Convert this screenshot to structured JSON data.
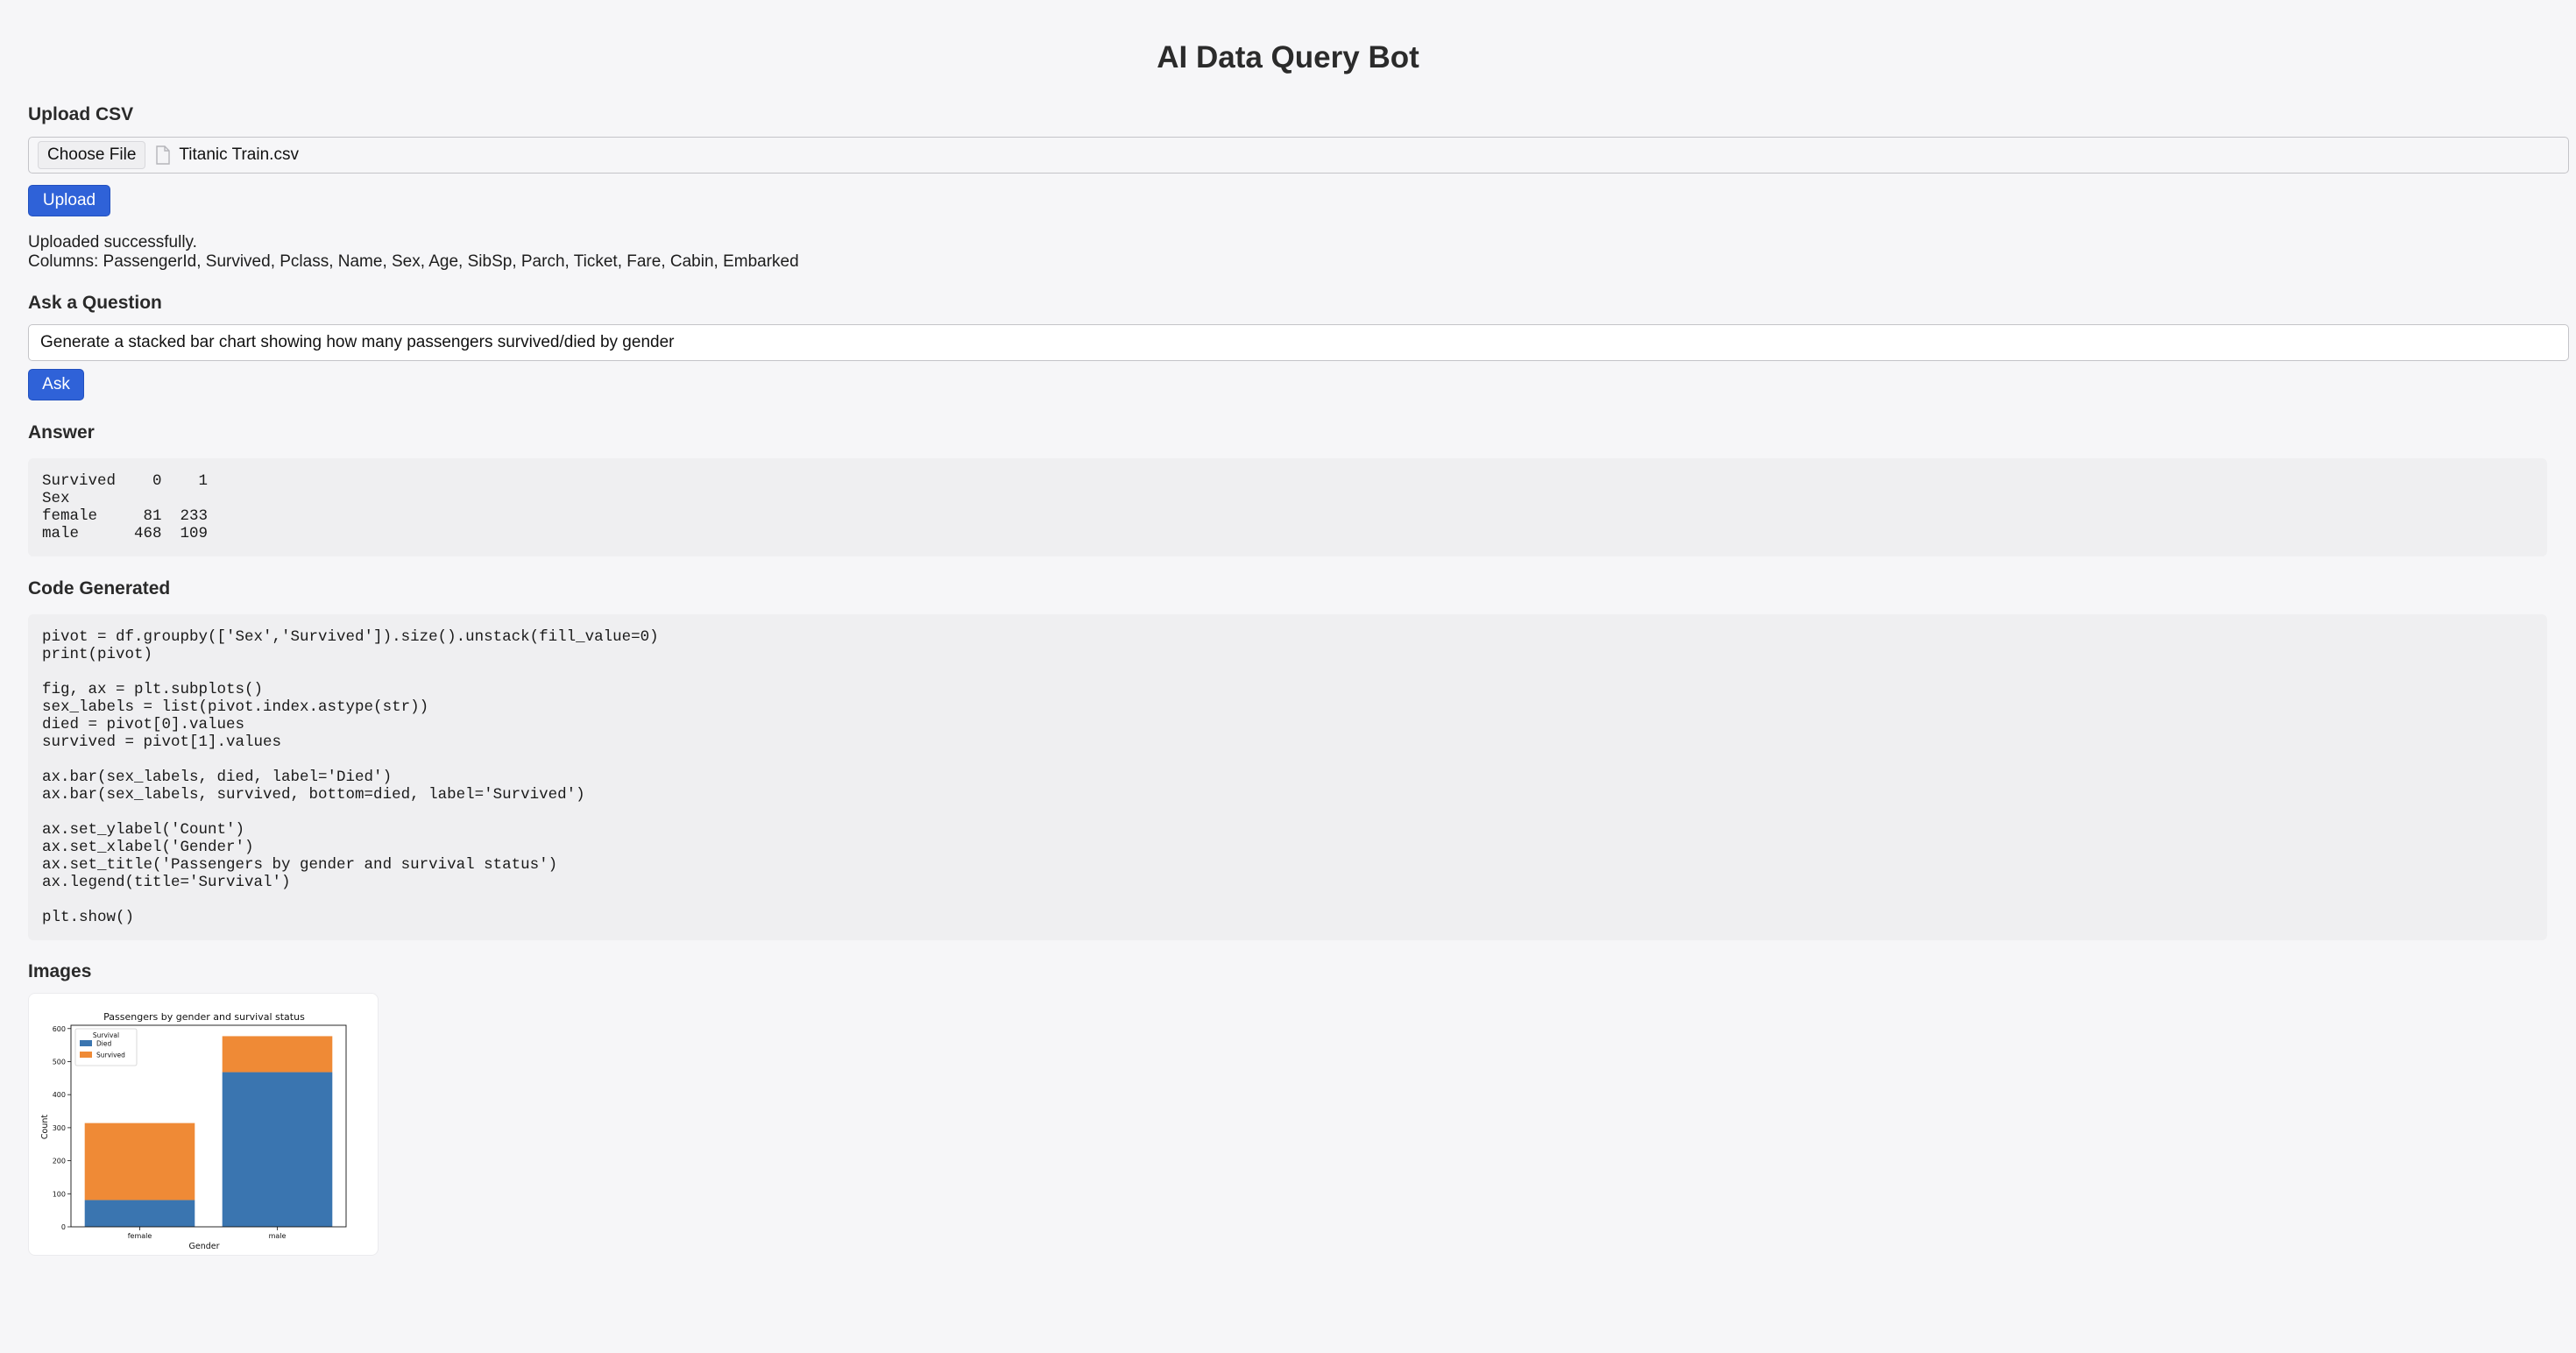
{
  "app": {
    "title": "AI Data Query Bot"
  },
  "upload": {
    "heading": "Upload CSV",
    "choose_file_label": "Choose File",
    "file_name": "Titanic Train.csv",
    "file_icon": "document-icon",
    "upload_button": "Upload",
    "status": "Uploaded successfully.",
    "columns": "Columns: PassengerId, Survived, Pclass, Name, Sex, Age, SibSp, Parch, Ticket, Fare, Cabin, Embarked"
  },
  "question": {
    "heading": "Ask a Question",
    "value": "Generate a stacked bar chart showing how many passengers survived/died by gender",
    "ask_button": "Ask"
  },
  "answer": {
    "heading": "Answer",
    "text": "Survived    0    1\nSex\nfemale     81  233\nmale      468  109"
  },
  "code": {
    "heading": "Code Generated",
    "text": "pivot = df.groupby(['Sex','Survived']).size().unstack(fill_value=0)\nprint(pivot)\n\nfig, ax = plt.subplots()\nsex_labels = list(pivot.index.astype(str))\ndied = pivot[0].values\nsurvived = pivot[1].values\n\nax.bar(sex_labels, died, label='Died')\nax.bar(sex_labels, survived, bottom=died, label='Survived')\n\nax.set_ylabel('Count')\nax.set_xlabel('Gender')\nax.set_title('Passengers by gender and survival status')\nax.legend(title='Survival')\n\nplt.show()"
  },
  "images": {
    "heading": "Images"
  },
  "colors": {
    "accent": "#2f62d8",
    "died": "#3a75b0",
    "survived": "#ef8a36"
  },
  "chart_data": {
    "type": "bar",
    "stacked": true,
    "title": "Passengers by gender and survival status",
    "xlabel": "Gender",
    "ylabel": "Count",
    "categories": [
      "female",
      "male"
    ],
    "series": [
      {
        "name": "Died",
        "values": [
          81,
          468
        ],
        "color": "#3a75b0"
      },
      {
        "name": "Survived",
        "values": [
          233,
          109
        ],
        "color": "#ef8a36"
      }
    ],
    "ylim": [
      0,
      610
    ],
    "yticks": [
      0,
      100,
      200,
      300,
      400,
      500,
      600
    ],
    "legend": {
      "title": "Survival",
      "placement": "top-left"
    },
    "grid": false
  }
}
